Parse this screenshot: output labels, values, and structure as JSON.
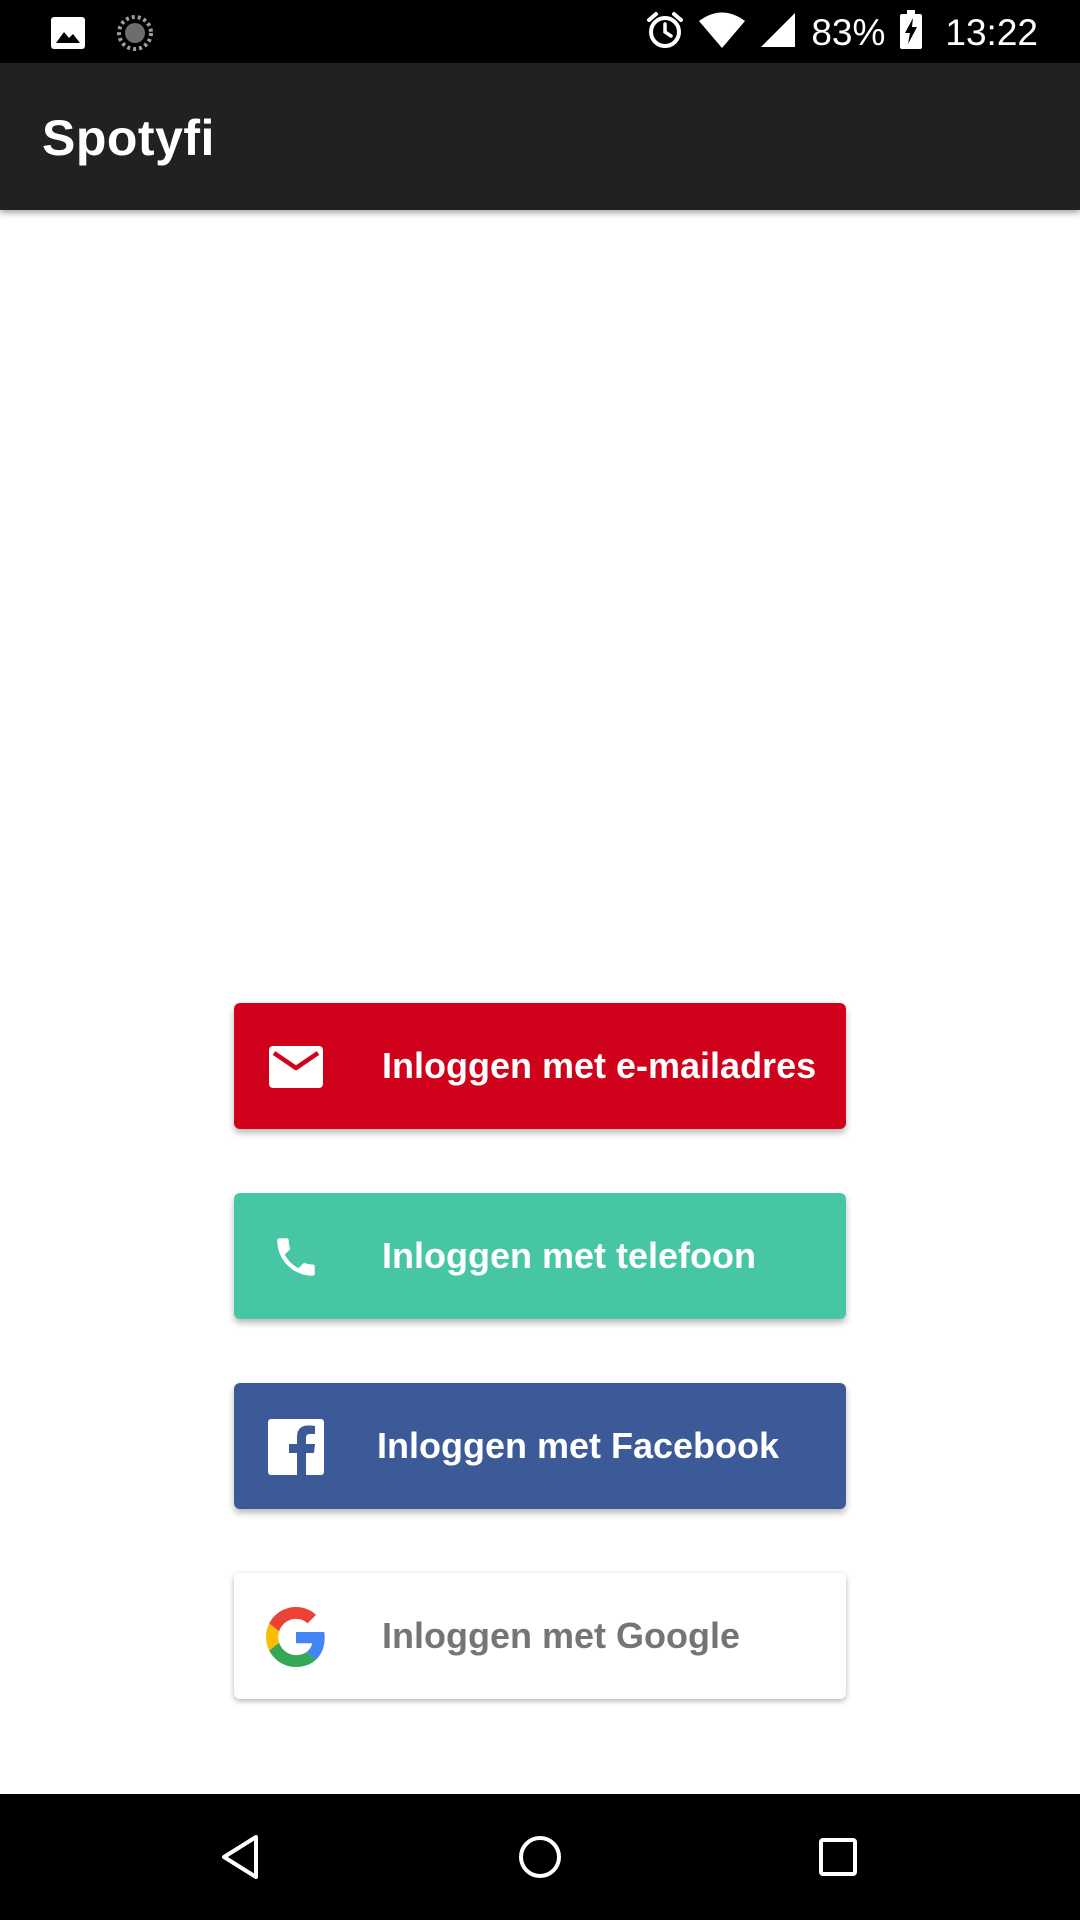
{
  "status_bar": {
    "battery_percent": "83%",
    "time": "13:22",
    "icons": [
      "image-icon",
      "sync-icon",
      "alarm-icon",
      "wifi-icon",
      "signal-icon",
      "battery-charging-icon"
    ]
  },
  "app_bar": {
    "title": "Spotyfi"
  },
  "login_buttons": [
    {
      "label": "Inloggen met e-mailadres",
      "icon": "mail-icon",
      "color": "#d0021b"
    },
    {
      "label": "Inloggen met telefoon",
      "icon": "phone-icon",
      "color": "#47c6a6"
    },
    {
      "label": "Inloggen met Facebook",
      "icon": "facebook-icon",
      "color": "#3d5a98"
    },
    {
      "label": "Inloggen met Google",
      "icon": "google-icon",
      "color": "#ffffff"
    }
  ],
  "nav_bar": {
    "icons": [
      "back-icon",
      "home-icon",
      "recents-icon"
    ]
  }
}
